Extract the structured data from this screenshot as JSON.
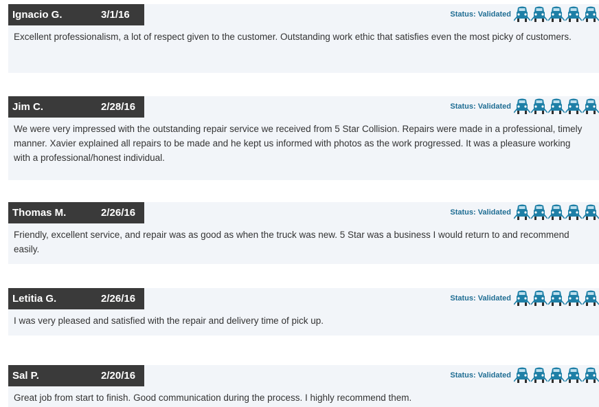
{
  "colors": {
    "name_tab_bg": "#3a3a3a",
    "card_bg": "#f2f5f9",
    "status_text": "#1f6d93",
    "car_icon": "#1e7fa6",
    "body_text": "#333333"
  },
  "icon": "car-icon",
  "reviews": [
    {
      "name": "Ignacio G.",
      "date": "3/1/16",
      "status": "Status: Validated",
      "rating": 5,
      "text": "Excellent professionalism, a lot of respect given to the customer. Outstanding work ethic that satisfies even the most picky of customers."
    },
    {
      "name": "Jim C.",
      "date": "2/28/16",
      "status": "Status: Validated",
      "rating": 5,
      "text": "We were very impressed with the outstanding repair service we received from 5 Star Collision. Repairs were made in a professional, timely manner. Xavier explained all repairs to be made and he kept us informed with photos as the work progressed. It was a pleasure working with a professional/honest individual."
    },
    {
      "name": "Thomas M.",
      "date": "2/26/16",
      "status": "Status: Validated",
      "rating": 5,
      "text": "Friendly, excellent service, and repair was as good as when the truck was new. 5 Star was a business I would return to and recommend easily."
    },
    {
      "name": "Letitia G.",
      "date": "2/26/16",
      "status": "Status: Validated",
      "rating": 5,
      "text": "I was very pleased and satisfied with the repair and delivery time of pick up."
    },
    {
      "name": "Sal P.",
      "date": "2/20/16",
      "status": "Status: Validated",
      "rating": 5,
      "text": "Great job from start to finish. Good communication during the process. I highly recommend them."
    }
  ]
}
